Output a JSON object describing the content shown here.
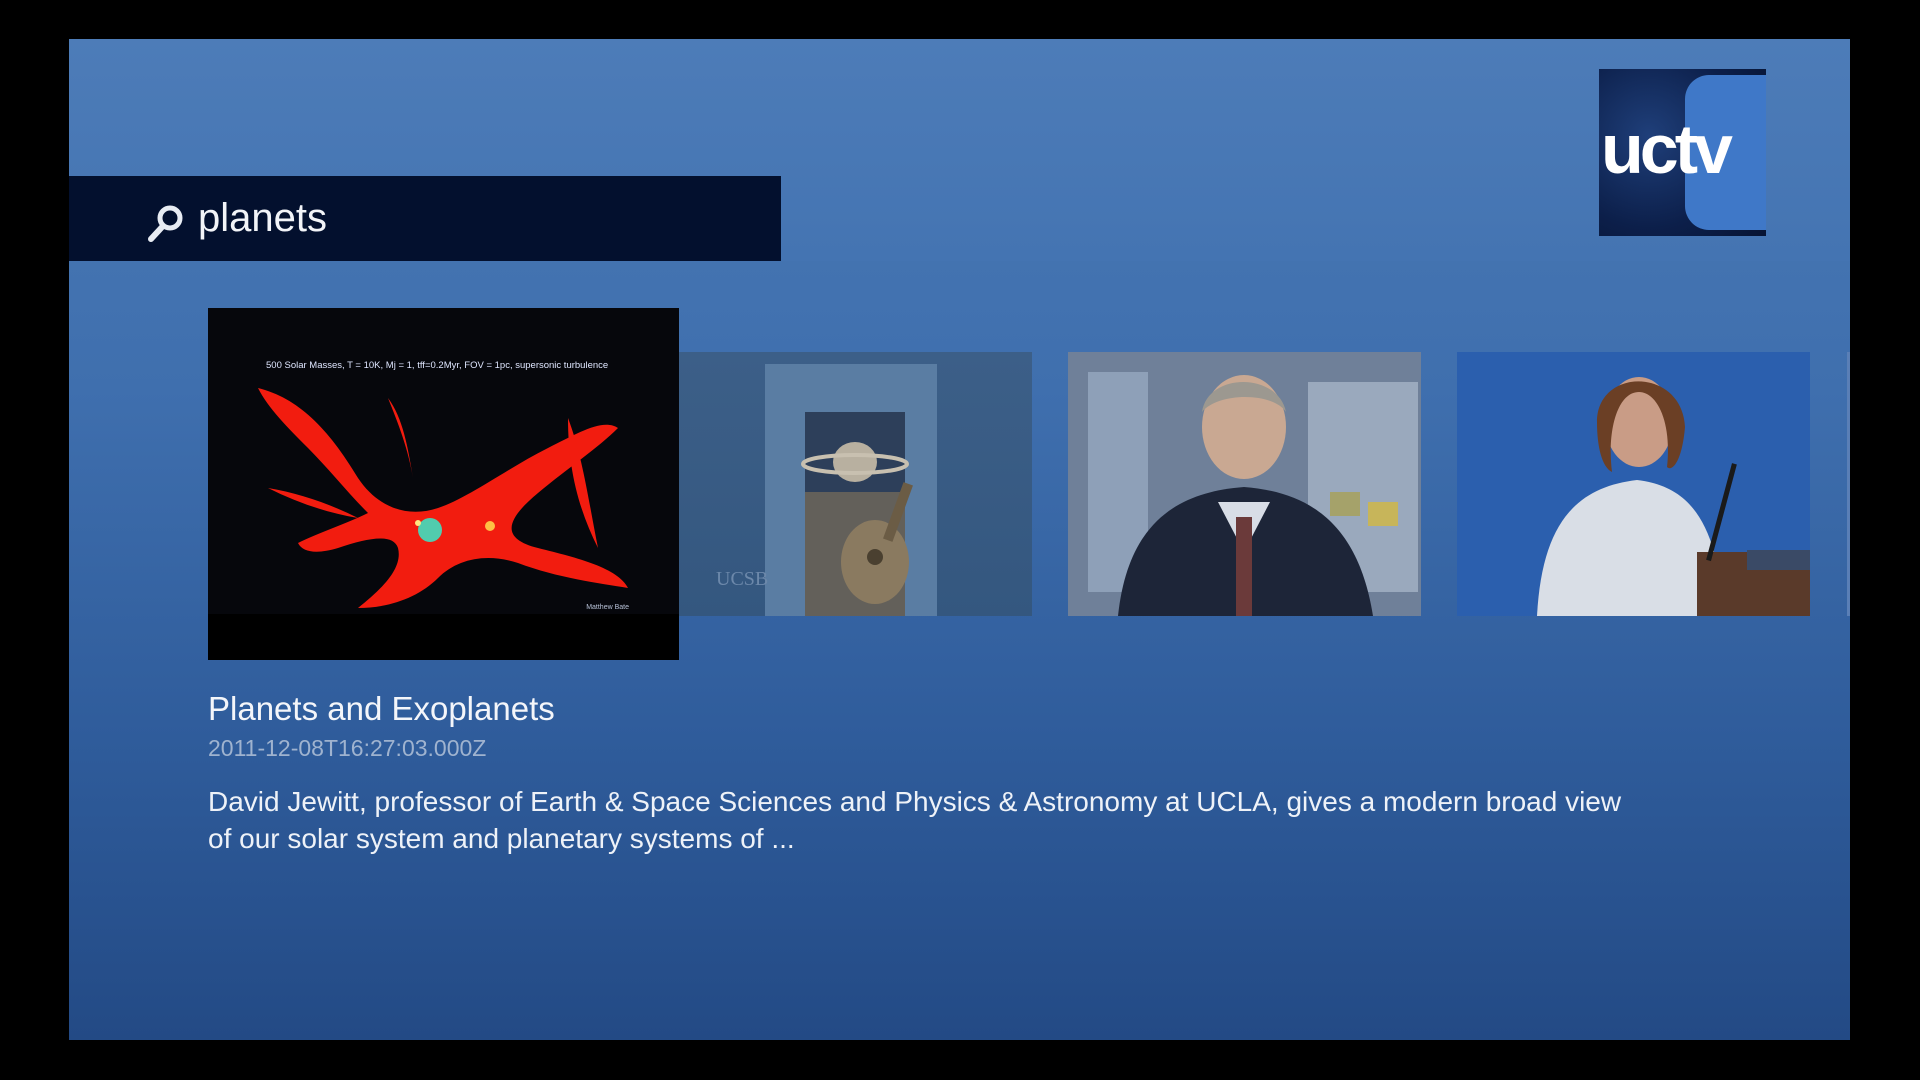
{
  "search": {
    "query": "planets"
  },
  "logo": {
    "text": "uctv"
  },
  "results": [
    {
      "caption": "500 Solar Masses, T = 10K, Mj = 1, tff=0.2Myr, FOV = 1pc, supersonic turbulence",
      "credit": "Matthew Bate"
    },
    {
      "watermark": "UCSB"
    },
    {},
    {}
  ],
  "selected": {
    "title": "Planets and Exoplanets",
    "date": "2011-12-08T16:27:03.000Z",
    "description": "David Jewitt, professor of Earth & Space Sciences and Physics & Astronomy at UCLA, gives a modern broad view of our solar system and planetary systems of ..."
  },
  "colors": {
    "search_bg": "#03102e",
    "screen_top": "#4a7ab5",
    "screen_bottom": "#234a85",
    "logo_blue": "#3f78c8"
  }
}
